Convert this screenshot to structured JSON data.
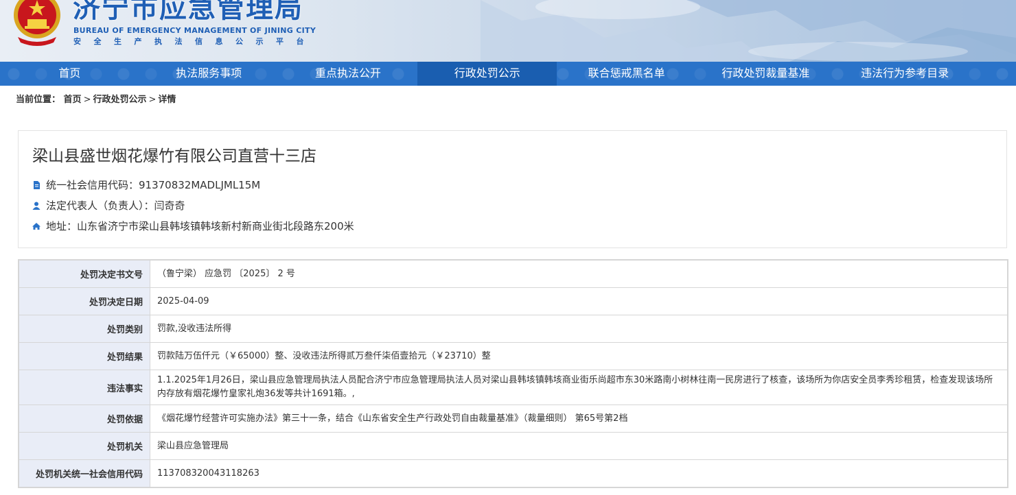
{
  "header": {
    "title": "济宁市应急管理局",
    "english": "BUREAU OF EMERGENCY MANAGEMENT OF JINING CITY",
    "subtitle": "安全生产执法信息公示平台"
  },
  "nav": {
    "items": [
      {
        "label": "首页"
      },
      {
        "label": "执法服务事项"
      },
      {
        "label": "重点执法公开"
      },
      {
        "label": "行政处罚公示"
      },
      {
        "label": "联合惩戒黑名单"
      },
      {
        "label": "行政处罚裁量基准"
      },
      {
        "label": "违法行为参考目录"
      }
    ],
    "active_index": 3
  },
  "breadcrumb": {
    "prefix": "当前位置：",
    "home": "首页",
    "section": "行政处罚公示",
    "current": "详情",
    "separator": ">"
  },
  "company": {
    "name": "梁山县盛世烟花爆竹有限公司直营十三店",
    "credit_code": "统一社会信用代码：91370832MADLJML15M",
    "legal_rep": "法定代表人（负责人）：闫奇奇",
    "address": "地址：山东省济宁市梁山县韩垓镇韩垓新村新商业街北段路东200米"
  },
  "details": [
    {
      "label": "处罚决定书文号",
      "value": "（鲁宁梁） 应急罚 〔2025〕 2 号"
    },
    {
      "label": "处罚决定日期",
      "value": "2025-04-09"
    },
    {
      "label": "处罚类别",
      "value": "罚款,没收违法所得"
    },
    {
      "label": "处罚结果",
      "value": "罚款陆万伍仟元（￥65000）整、没收违法所得贰万叁仟柒佰壹拾元（￥23710）整"
    },
    {
      "label": "违法事实",
      "value": "1.1.2025年1月26日，梁山县应急管理局执法人员配合济宁市应急管理局执法人员对梁山县韩垓镇韩垓商业街乐尚超市东30米路南小树林往南一民房进行了核查，该场所为你店安全员李秀珍租赁，检查发现该场所内存放有烟花爆竹皇家礼炮36发等共计1691箱。,"
    },
    {
      "label": "处罚依据",
      "value": "《烟花爆竹经营许可实施办法》第三十一条，结合《山东省安全生产行政处罚自由裁量基准》（裁量细则） 第65号第2档"
    },
    {
      "label": "处罚机关",
      "value": "梁山县应急管理局"
    },
    {
      "label": "处罚机关统一社会信用代码",
      "value": "113708320043118263"
    }
  ],
  "colors": {
    "nav_bg": "#2a73c9",
    "nav_active": "#1a5eb0",
    "title_blue": "#1f5fb5",
    "label_bg": "#e9edf7"
  }
}
